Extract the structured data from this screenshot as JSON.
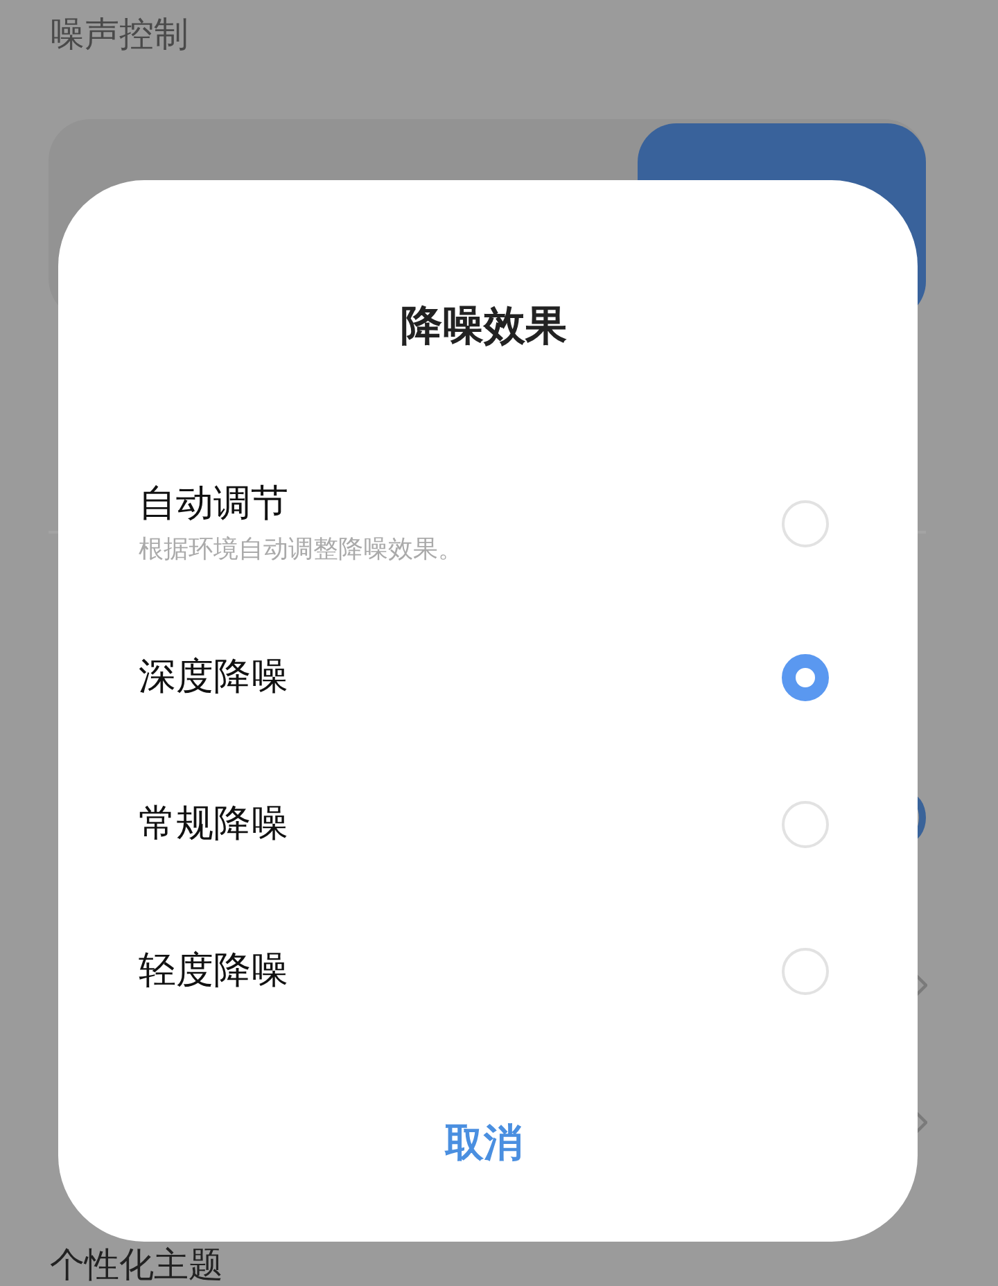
{
  "page": {
    "title": "噪声控制",
    "bottom_item": "个性化主题"
  },
  "dialog": {
    "title": "降噪效果",
    "options": [
      {
        "label": "自动调节",
        "description": "根据环境自动调整降噪效果。",
        "selected": false
      },
      {
        "label": "深度降噪",
        "selected": true
      },
      {
        "label": "常规降噪",
        "selected": false
      },
      {
        "label": "轻度降噪",
        "selected": false
      }
    ],
    "cancel": "取消"
  }
}
